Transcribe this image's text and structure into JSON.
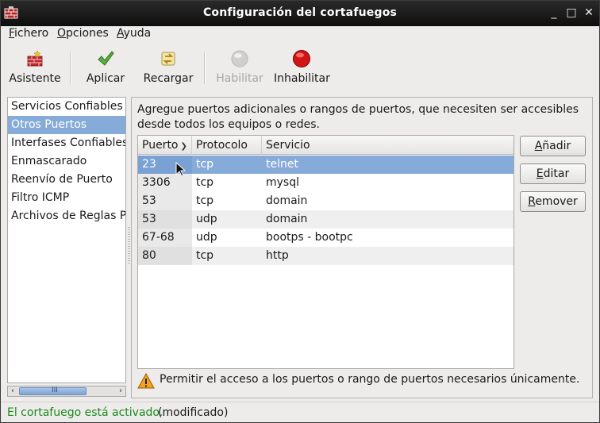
{
  "window": {
    "title": "Configuración del cortafuegos"
  },
  "menu": {
    "items": [
      {
        "label": "Fichero",
        "mnemonic": "F",
        "rest": "ichero"
      },
      {
        "label": "Opciones",
        "mnemonic": "O",
        "rest": "pciones"
      },
      {
        "label": "Ayuda",
        "mnemonic": "A",
        "rest": "yuda"
      }
    ]
  },
  "toolbar": {
    "wizard": {
      "label": "Asistente",
      "icon": "wizard-firewall-icon"
    },
    "apply": {
      "label": "Aplicar",
      "icon": "checkmark-icon"
    },
    "reload": {
      "label": "Recargar",
      "icon": "reload-icon"
    },
    "enable": {
      "label": "Habilitar",
      "icon": "grey-circle-icon",
      "disabled": true
    },
    "disable": {
      "label": "Inhabilitar",
      "icon": "red-circle-icon"
    }
  },
  "sidebar": {
    "items": [
      {
        "label": "Servicios Confiables",
        "selected": false
      },
      {
        "label": "Otros Puertos",
        "selected": true
      },
      {
        "label": "Interfases Confiables",
        "selected": false
      },
      {
        "label": "Enmascarado",
        "selected": false
      },
      {
        "label": "Reenvío de Puerto",
        "selected": false
      },
      {
        "label": "Filtro ICMP",
        "selected": false
      },
      {
        "label": "Archivos de Reglas Pe",
        "selected": false
      }
    ]
  },
  "main": {
    "description": "Agregue puertos adicionales o rangos de puertos, que necesiten ser accesibles desde todos los equipos o redes.",
    "table": {
      "columns": [
        "Puerto",
        "Protocolo",
        "Servicio"
      ],
      "rows": [
        {
          "port": "23",
          "protocol": "tcp",
          "service": "telnet",
          "selected": true
        },
        {
          "port": "3306",
          "protocol": "tcp",
          "service": "mysql",
          "selected": false
        },
        {
          "port": "53",
          "protocol": "tcp",
          "service": "domain",
          "selected": false
        },
        {
          "port": "53",
          "protocol": "udp",
          "service": "domain",
          "selected": false
        },
        {
          "port": "67-68",
          "protocol": "udp",
          "service": "bootps - bootpc",
          "selected": false
        },
        {
          "port": "80",
          "protocol": "tcp",
          "service": "http",
          "selected": false
        }
      ]
    },
    "buttons": {
      "add": {
        "label": "Añadir",
        "mnemonic": "A",
        "rest": "ñadir"
      },
      "edit": {
        "label": "Editar",
        "mnemonic": "E",
        "rest": "ditar"
      },
      "remove": {
        "label": "Remover",
        "mnemonic": "R",
        "rest": "emover"
      }
    },
    "warning": "Permitir el acceso a los puertos o rango de puertos necesarios únicamente."
  },
  "status": {
    "message": "El cortafuego está activado.",
    "extra": "(modificado)"
  },
  "colors": {
    "selection": "#86abd9",
    "status_ok": "#1b8a1b",
    "titlebar": "#1a1a1a"
  }
}
